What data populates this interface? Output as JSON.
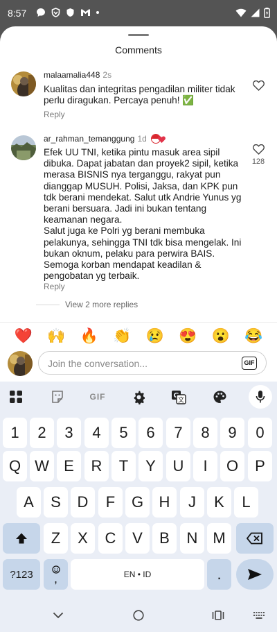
{
  "status_bar": {
    "time": "8:57"
  },
  "sheet": {
    "title": "Comments"
  },
  "comments": [
    {
      "username": "malaamalia448",
      "time": "2s",
      "text": "Kualitas dan integritas pengadilan militer tidak perlu diragukan. Percaya penuh! ✅",
      "reply_label": "Reply"
    },
    {
      "username": "ar_rahman_temanggung",
      "time": "1d",
      "text": "Efek UU TNI, ketika pintu masuk area sipil dibuka. Dapat jabatan dan proyek2 sipil, ketika merasa BISNIS nya terganggu, rakyat pun dianggap MUSUH. Polisi, Jaksa, dan KPK pun tdk berani mendekat. Salut utk Andrie Yunus yg berani bersuara. Jadi ini bukan tentang keamanan negara.\nSalut juga ke Polri yg berani membuka pelakunya, sehingga TNI tdk bisa mengelak. Ini bukan oknum, pelaku para perwira BAIS. Semoga korban mendapat keadilan & pengobatan yg terbaik.",
      "reply_label": "Reply",
      "like_count": "128"
    }
  ],
  "view_more_replies": "View 2 more replies",
  "emoji_bar": [
    "❤️",
    "🙌",
    "🔥",
    "👏",
    "😢",
    "😍",
    "😮",
    "😂"
  ],
  "compose": {
    "placeholder": "Join the conversation...",
    "gif_label": "GIF"
  },
  "keyboard": {
    "toolbar_gif_label": "GIF",
    "number_row": [
      "1",
      "2",
      "3",
      "4",
      "5",
      "6",
      "7",
      "8",
      "9",
      "0"
    ],
    "row1": [
      "Q",
      "W",
      "E",
      "R",
      "T",
      "Y",
      "U",
      "I",
      "O",
      "P"
    ],
    "row2": [
      "A",
      "S",
      "D",
      "F",
      "G",
      "H",
      "J",
      "K",
      "L"
    ],
    "row3": [
      "Z",
      "X",
      "C",
      "V",
      "B",
      "N",
      "M"
    ],
    "symbols_label": "?123",
    "comma_label": ",",
    "space_label": "EN • ID",
    "period_label": "."
  },
  "colors": {
    "sheet_background": "#ffffff",
    "keyboard_background": "#eaeef6",
    "special_key": "#c6d6ea",
    "muted_text": "#7a7a7a"
  }
}
